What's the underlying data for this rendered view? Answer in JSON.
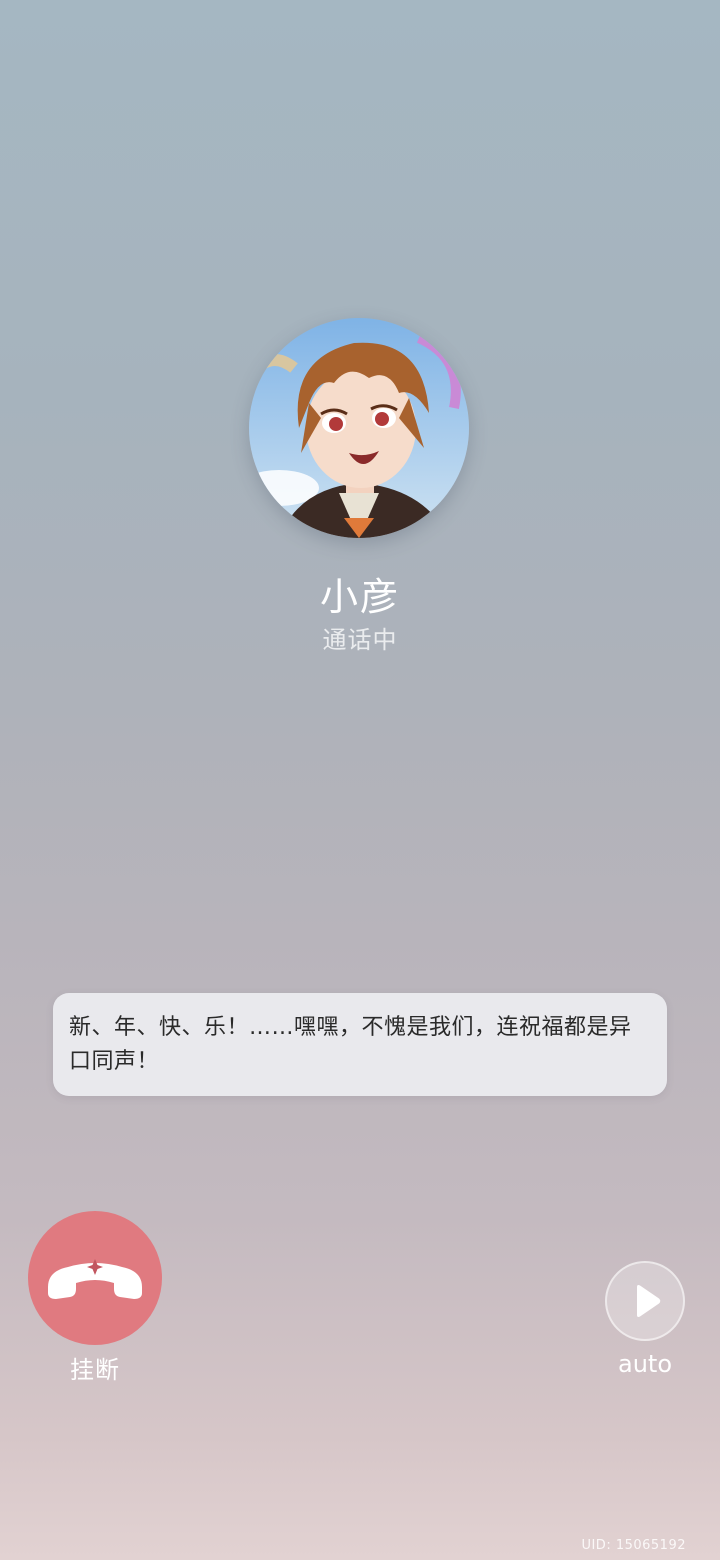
{
  "caller": {
    "name": "小彦",
    "status": "通话中",
    "avatar_icon": "character-portrait"
  },
  "dialogue": {
    "text": "新、年、快、乐！……嘿嘿，不愧是我们，连祝福都是异口同声！"
  },
  "controls": {
    "hangup_label": "挂断",
    "hangup_icon": "phone-hangup-icon",
    "auto_label": "auto",
    "auto_icon": "play-icon"
  },
  "footer": {
    "uid": "UID: 15065192"
  },
  "colors": {
    "hangup": "#e07a80",
    "bubble": "#ececf0",
    "text_light": "#ffffff"
  }
}
